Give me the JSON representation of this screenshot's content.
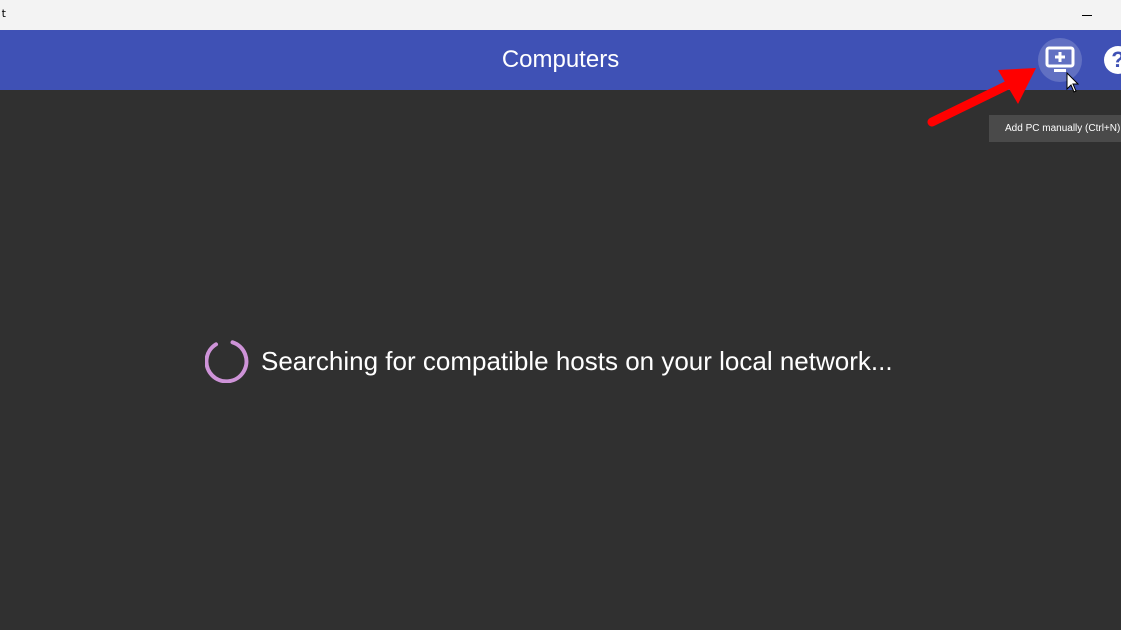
{
  "window": {
    "title_fragment": "t"
  },
  "toolbar": {
    "title": "Computers",
    "add_pc_icon": "add-monitor-icon",
    "help_icon": "help-icon",
    "help_glyph": "?"
  },
  "tooltip": {
    "text": "Add PC manually (Ctrl+N)"
  },
  "status": {
    "text": "Searching for compatible hosts on your local network..."
  },
  "colors": {
    "toolbar": "#3f51b5",
    "background": "#303030",
    "spinner": "#ce93d8",
    "annotation_arrow": "#ff0000"
  }
}
